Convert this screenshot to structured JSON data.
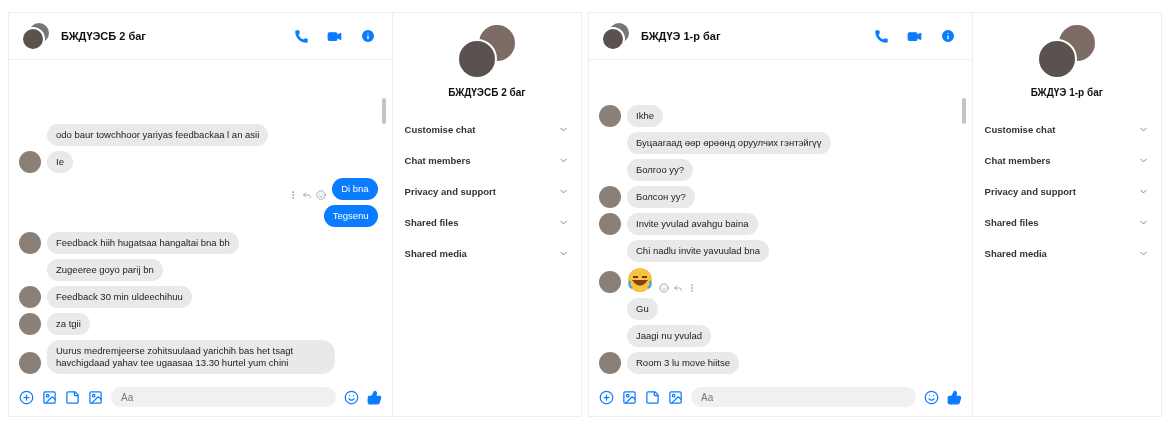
{
  "panels": [
    {
      "title": "БЖДҮЭСБ 2 баг",
      "details_title": "БЖДҮЭСБ 2 баг",
      "placeholder": "Aa",
      "messages": [
        {
          "kind": "text",
          "outgoing": false,
          "avatar": false,
          "text": "odo baur towchhoor yariyas feedbackaa l an asii"
        },
        {
          "kind": "text",
          "outgoing": false,
          "avatar": true,
          "text": "Ie"
        },
        {
          "kind": "text",
          "outgoing": true,
          "text": "Di bna"
        },
        {
          "kind": "text",
          "outgoing": true,
          "text": "Tegsenu"
        },
        {
          "kind": "text",
          "outgoing": false,
          "avatar": true,
          "text": "Feedback hiih hugatsaa hangaltai bna bh"
        },
        {
          "kind": "text",
          "outgoing": false,
          "avatar": false,
          "text": "Zugeeree goyo parij bn"
        },
        {
          "kind": "text",
          "outgoing": false,
          "avatar": true,
          "text": "Feedback 30 min uldeechihuu"
        },
        {
          "kind": "text",
          "outgoing": false,
          "avatar": true,
          "text": "za tgii"
        },
        {
          "kind": "text",
          "outgoing": false,
          "avatar": true,
          "text": "Uurus medremjeerse zohitsuulaad yarichih bas het tsagt havchigdaad yahav tee ugaasaa 13.30 hurtel yum chini"
        }
      ],
      "detail_items": [
        "Customise chat",
        "Chat members",
        "Privacy and support",
        "Shared files",
        "Shared media"
      ]
    },
    {
      "title": "БЖДҮЭ 1-р баг",
      "details_title": "БЖДҮЭ 1-р баг",
      "placeholder": "Aa",
      "messages": [
        {
          "kind": "text",
          "outgoing": false,
          "avatar": true,
          "text": "Ikhe"
        },
        {
          "kind": "text",
          "outgoing": false,
          "avatar": false,
          "text": "Буцаагаад өөр өрөөнд оруулчих гэнтэйгүү"
        },
        {
          "kind": "text",
          "outgoing": false,
          "avatar": false,
          "text": "Болгоо уу?"
        },
        {
          "kind": "text",
          "outgoing": false,
          "avatar": true,
          "text": "Болсон уу?"
        },
        {
          "kind": "text",
          "outgoing": false,
          "avatar": true,
          "text": "Invite yvulad avahgu baina"
        },
        {
          "kind": "text",
          "outgoing": false,
          "avatar": false,
          "text": "Chi nadlu invite yavuulad bna"
        },
        {
          "kind": "emoji",
          "outgoing": false,
          "avatar": true
        },
        {
          "kind": "text",
          "outgoing": false,
          "avatar": false,
          "text": "Gu"
        },
        {
          "kind": "text",
          "outgoing": false,
          "avatar": false,
          "text": "Jaagi nu yvulad"
        },
        {
          "kind": "text",
          "outgoing": false,
          "avatar": true,
          "text": "Room 3 lu move hiitse"
        }
      ],
      "detail_items": [
        "Customise chat",
        "Chat members",
        "Privacy and support",
        "Shared files",
        "Shared media"
      ]
    }
  ]
}
